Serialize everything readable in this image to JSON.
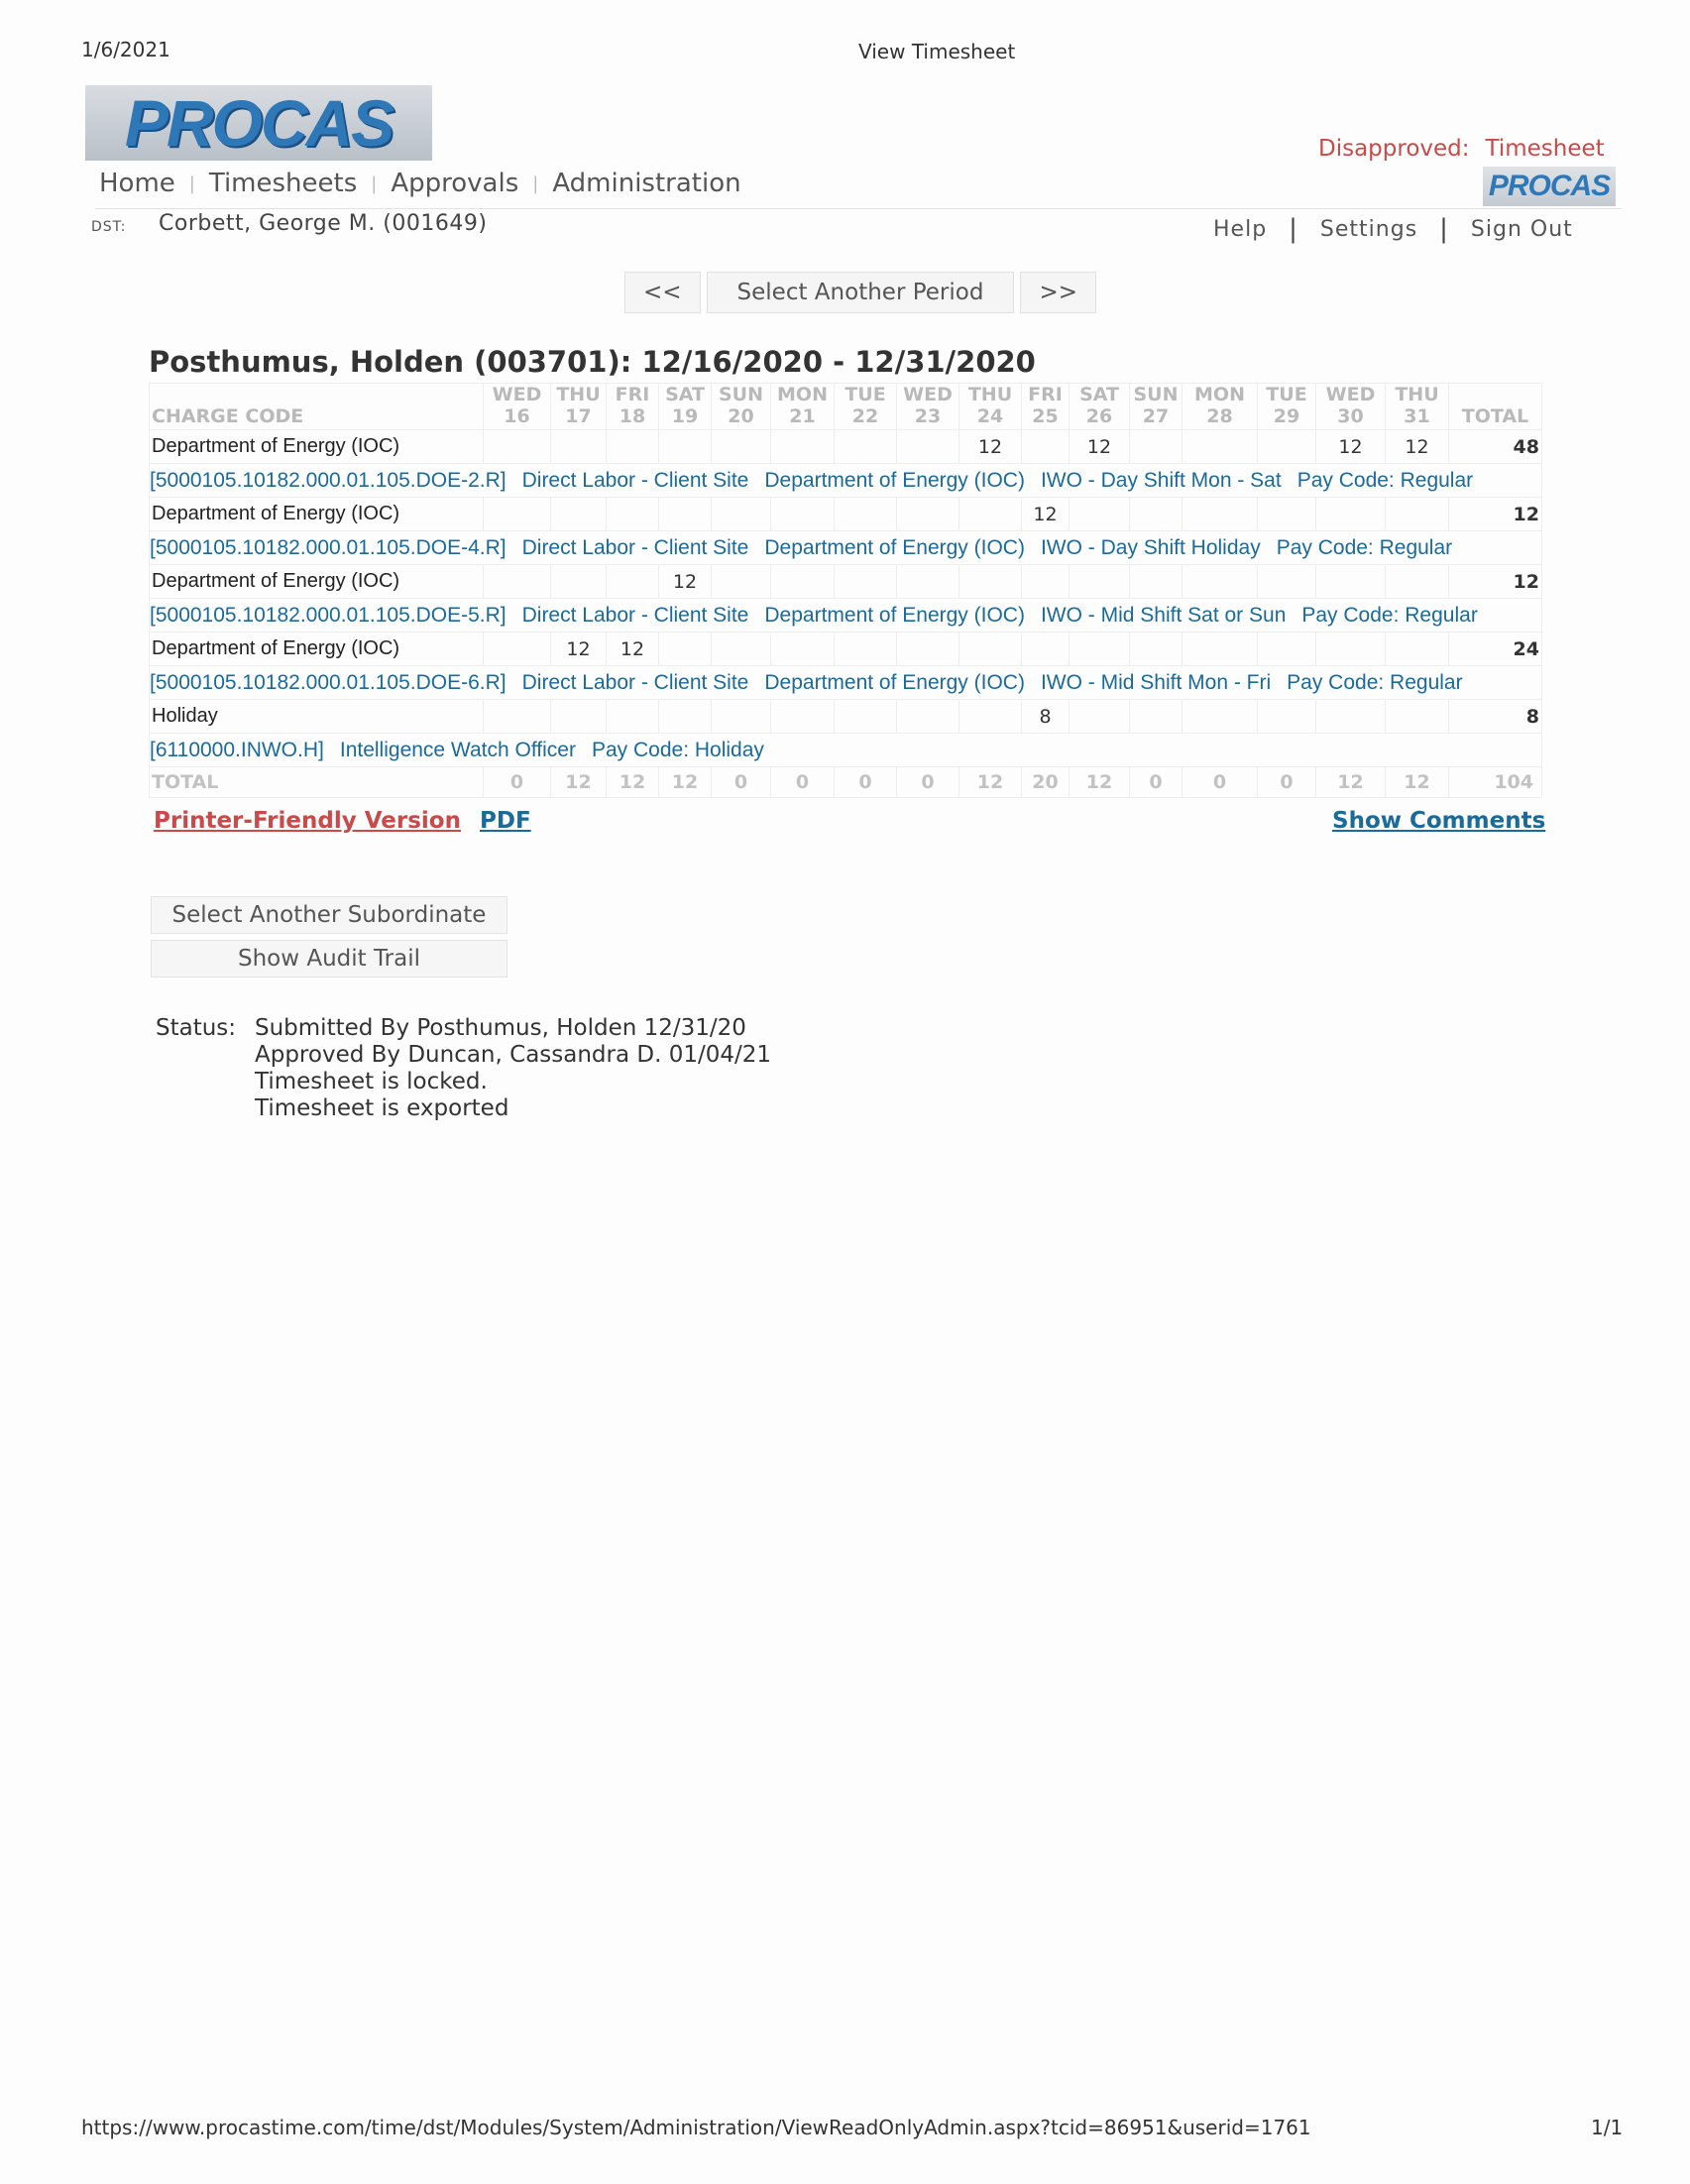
{
  "print": {
    "date": "1/6/2021",
    "title": "View Timesheet",
    "url": "https://www.procastime.com/time/dst/Modules/System/Administration/ViewReadOnlyAdmin.aspx?tcid=86951&userid=1761",
    "page": "1/1"
  },
  "logo": {
    "text": "PROCAS",
    "small_text": "PROCAS"
  },
  "status_banner": {
    "label": "Disapproved:",
    "value": "Timesheet"
  },
  "nav": [
    "Home",
    "Timesheets",
    "Approvals",
    "Administration"
  ],
  "user": {
    "label": "DST:",
    "name": "Corbett, George M. (001649)"
  },
  "toplinks": {
    "help": "Help",
    "settings": "Settings",
    "signout": "Sign Out"
  },
  "period": {
    "prev": "<<",
    "select": "Select Another Period",
    "next": ">>"
  },
  "heading": "Posthumus, Holden (003701): 12/16/2020 - 12/31/2020",
  "table": {
    "charge_code_header": "CHARGE CODE",
    "total_header": "TOTAL",
    "days": [
      {
        "dow": "WED",
        "d": "16"
      },
      {
        "dow": "THU",
        "d": "17"
      },
      {
        "dow": "FRI",
        "d": "18"
      },
      {
        "dow": "SAT",
        "d": "19"
      },
      {
        "dow": "SUN",
        "d": "20"
      },
      {
        "dow": "MON",
        "d": "21"
      },
      {
        "dow": "TUE",
        "d": "22"
      },
      {
        "dow": "WED",
        "d": "23"
      },
      {
        "dow": "THU",
        "d": "24"
      },
      {
        "dow": "FRI",
        "d": "25"
      },
      {
        "dow": "SAT",
        "d": "26"
      },
      {
        "dow": "SUN",
        "d": "27"
      },
      {
        "dow": "MON",
        "d": "28"
      },
      {
        "dow": "TUE",
        "d": "29"
      },
      {
        "dow": "WED",
        "d": "30"
      },
      {
        "dow": "THU",
        "d": "31"
      }
    ],
    "rows": [
      {
        "project": "Department of Energy (IOC)",
        "hours": [
          "",
          "",
          "",
          "",
          "",
          "",
          "",
          "",
          "12",
          "",
          "12",
          "",
          "",
          "",
          "12",
          "12"
        ],
        "total": "48",
        "code": [
          "[5000105.10182.000.01.105.DOE-2.R]",
          "Direct Labor - Client Site",
          "Department of Energy (IOC)",
          "IWO - Day Shift Mon - Sat",
          "Pay Code: Regular"
        ]
      },
      {
        "project": "Department of Energy (IOC)",
        "hours": [
          "",
          "",
          "",
          "",
          "",
          "",
          "",
          "",
          "",
          "12",
          "",
          "",
          "",
          "",
          "",
          ""
        ],
        "total": "12",
        "code": [
          "[5000105.10182.000.01.105.DOE-4.R]",
          "Direct Labor - Client Site",
          "Department of Energy (IOC)",
          "IWO - Day Shift Holiday",
          "Pay Code: Regular"
        ]
      },
      {
        "project": "Department of Energy (IOC)",
        "hours": [
          "",
          "",
          "",
          "12",
          "",
          "",
          "",
          "",
          "",
          "",
          "",
          "",
          "",
          "",
          "",
          ""
        ],
        "total": "12",
        "code": [
          "[5000105.10182.000.01.105.DOE-5.R]",
          "Direct Labor - Client Site",
          "Department of Energy (IOC)",
          "IWO - Mid Shift Sat or Sun",
          "Pay Code: Regular"
        ]
      },
      {
        "project": "Department of Energy (IOC)",
        "hours": [
          "",
          "12",
          "12",
          "",
          "",
          "",
          "",
          "",
          "",
          "",
          "",
          "",
          "",
          "",
          "",
          ""
        ],
        "total": "24",
        "code": [
          "[5000105.10182.000.01.105.DOE-6.R]",
          "Direct Labor - Client Site",
          "Department of Energy (IOC)",
          "IWO - Mid Shift Mon - Fri",
          "Pay Code: Regular"
        ]
      },
      {
        "project": "Holiday",
        "hours": [
          "",
          "",
          "",
          "",
          "",
          "",
          "",
          "",
          "",
          "8",
          "",
          "",
          "",
          "",
          "",
          ""
        ],
        "total": "8",
        "code": [
          "[6110000.INWO.H]",
          "Intelligence Watch Officer",
          "Pay Code: Holiday"
        ]
      }
    ],
    "totals_label": "TOTAL",
    "totals": [
      "0",
      "12",
      "12",
      "12",
      "0",
      "0",
      "0",
      "0",
      "12",
      "20",
      "12",
      "0",
      "0",
      "0",
      "12",
      "12"
    ],
    "grand_total": "104"
  },
  "links": {
    "printer": "Printer-Friendly Version",
    "pdf": "PDF",
    "comments": "Show Comments"
  },
  "buttons": {
    "subordinate": "Select Another Subordinate",
    "audit": "Show Audit Trail"
  },
  "status": {
    "label": "Status:",
    "lines": [
      "Submitted By Posthumus, Holden 12/31/20",
      "Approved By Duncan, Cassandra D. 01/04/21",
      "Timesheet is locked.",
      "Timesheet is exported"
    ]
  },
  "colors": {
    "link_blue": "#1a6a9a",
    "alert_red": "#c84a4a"
  }
}
